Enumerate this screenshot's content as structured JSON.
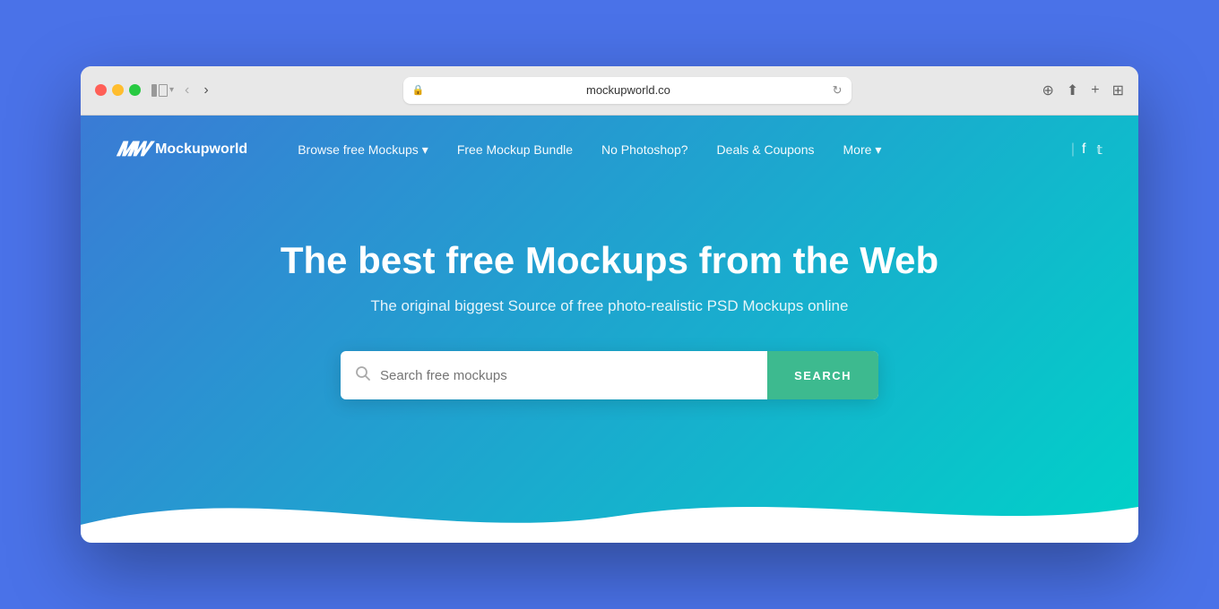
{
  "browser": {
    "url": "mockupworld.co",
    "back_arrow": "‹",
    "forward_arrow": "›",
    "reload": "↻",
    "actions": [
      "⊕",
      "⎙",
      "+",
      "⊞"
    ]
  },
  "nav": {
    "logo_icon": "𝑾",
    "logo_text": "Mockupworld",
    "links": [
      {
        "label": "Browse free Mockups",
        "has_dropdown": true
      },
      {
        "label": "Free Mockup Bundle",
        "has_dropdown": false
      },
      {
        "label": "No Photoshop?",
        "has_dropdown": false
      },
      {
        "label": "Deals & Coupons",
        "has_dropdown": false
      },
      {
        "label": "More",
        "has_dropdown": true
      }
    ],
    "social_facebook": "f",
    "social_twitter": "𝕥"
  },
  "hero": {
    "title": "The best free Mockups from the Web",
    "subtitle": "The original biggest Source of free photo-realistic PSD Mockups online",
    "search_placeholder": "Search free mockups",
    "search_button": "SEARCH"
  },
  "colors": {
    "bg_page": "#4a72e8",
    "gradient_start": "#3a7bd5",
    "gradient_end": "#00d2c8",
    "search_btn": "#3dba8f",
    "white": "#ffffff"
  }
}
